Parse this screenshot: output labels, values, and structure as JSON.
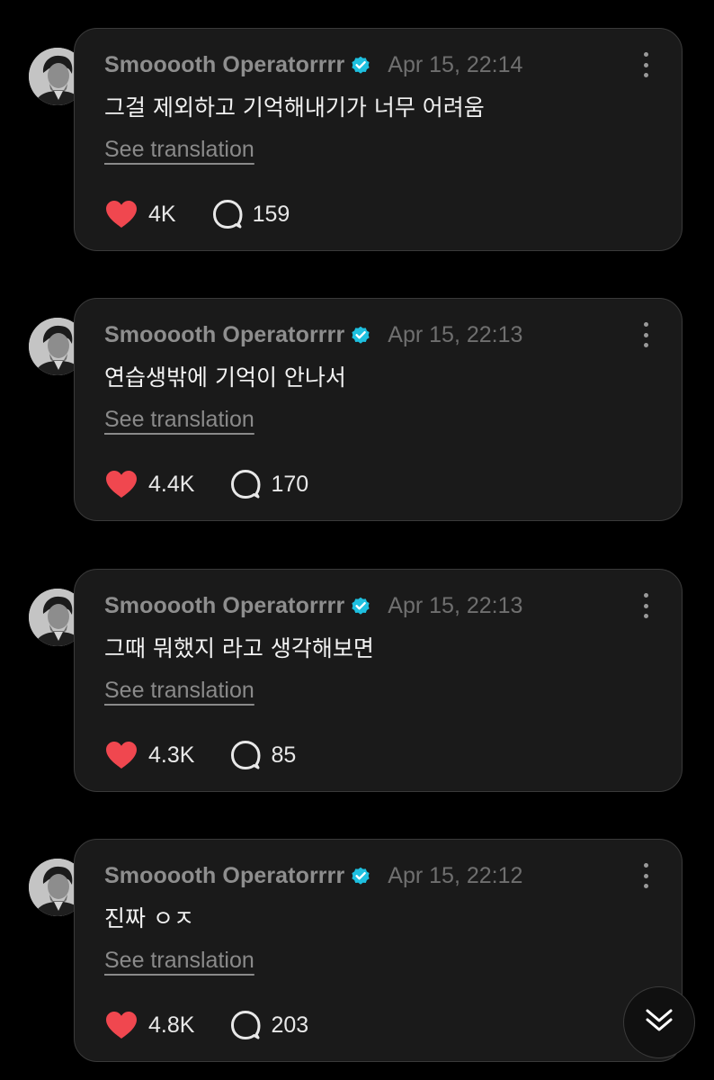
{
  "colors": {
    "background": "#000000",
    "card": "#1a1a1a",
    "card_border": "#3a3a3a",
    "verified_badge": "#1ec0e0",
    "like_heart": "#f0474f",
    "username": "#8e8e8e",
    "timestamp": "#6f6f6f"
  },
  "posts": [
    {
      "username": "Smooooth Operatorrrr",
      "verified": true,
      "timestamp": "Apr 15, 22:14",
      "text": "그걸 제외하고 기억해내기가 너무 어려움",
      "translate_label": "See translation",
      "likes": "4K",
      "replies": "159",
      "liked": true
    },
    {
      "username": "Smooooth Operatorrrr",
      "verified": true,
      "timestamp": "Apr 15, 22:13",
      "text": "연습생밖에 기억이 안나서",
      "translate_label": "See translation",
      "likes": "4.4K",
      "replies": "170",
      "liked": true
    },
    {
      "username": "Smooooth Operatorrrr",
      "verified": true,
      "timestamp": "Apr 15, 22:13",
      "text": "그때 뭐했지 라고 생각해보면",
      "translate_label": "See translation",
      "likes": "4.3K",
      "replies": "85",
      "liked": true
    },
    {
      "username": "Smooooth Operatorrrr",
      "verified": true,
      "timestamp": "Apr 15, 22:12",
      "text": "진짜 ㅇㅈ",
      "translate_label": "See translation",
      "likes": "4.8K",
      "replies": "203",
      "liked": true
    }
  ],
  "icons": {
    "like": "heart-icon",
    "reply": "speech-bubble-icon",
    "more": "more-vertical-icon",
    "verified": "verified-badge-icon",
    "scroll_down": "double-chevron-down-icon"
  }
}
